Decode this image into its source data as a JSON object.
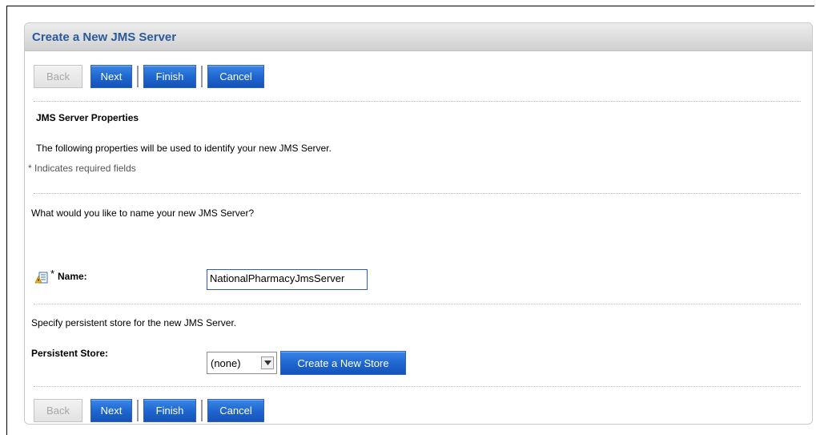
{
  "panel": {
    "title": "Create a New JMS Server"
  },
  "buttons": {
    "back": "Back",
    "next": "Next",
    "finish": "Finish",
    "cancel": "Cancel"
  },
  "section": {
    "heading": "JMS Server Properties",
    "description": "The following properties will be used to identify your new JMS Server.",
    "required_note": "* Indicates required fields"
  },
  "name_section": {
    "question": "What would you like to name your new JMS Server?",
    "required_star": "*",
    "label": "Name:",
    "value": "NationalPharmacyJmsServer"
  },
  "store_section": {
    "question": "Specify persistent store for the new JMS Server.",
    "label": "Persistent Store:",
    "selected": "(none)",
    "create_button": "Create a New Store"
  },
  "icons": {
    "field_help": "help-field-icon",
    "dropdown": "chevron-down-icon"
  },
  "colors": {
    "button_blue": "#1e65cf",
    "title_blue": "#2a5a9b"
  }
}
